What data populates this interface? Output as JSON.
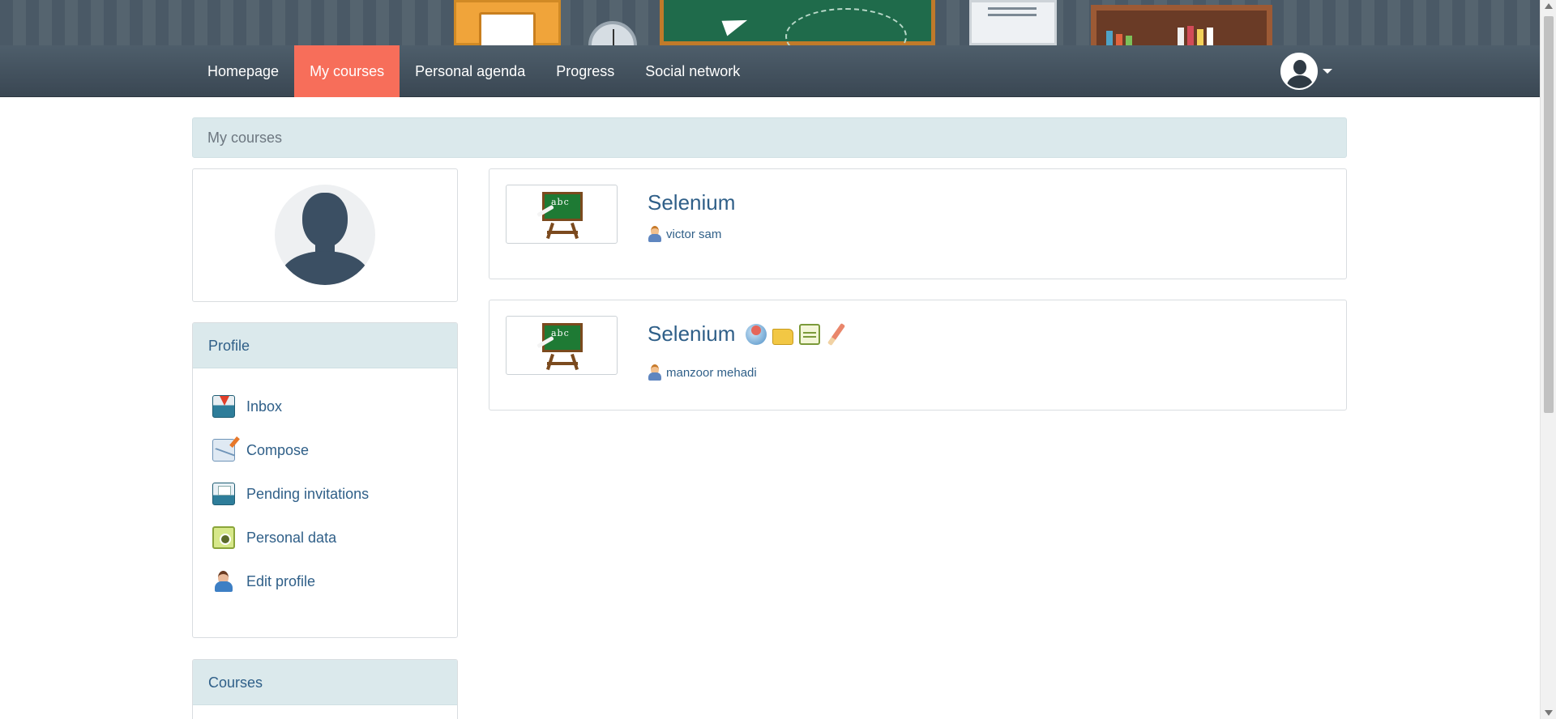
{
  "nav": {
    "items": [
      {
        "label": "Homepage",
        "active": false
      },
      {
        "label": "My courses",
        "active": true
      },
      {
        "label": "Personal agenda",
        "active": false
      },
      {
        "label": "Progress",
        "active": false
      },
      {
        "label": "Social network",
        "active": false
      }
    ],
    "active_color": "#f76e5a",
    "user_menu_icon": "user-avatar-icon"
  },
  "breadcrumb": {
    "label": "My courses"
  },
  "sidebar": {
    "profile": {
      "heading": "Profile",
      "items": [
        {
          "label": "Inbox",
          "icon": "inbox-icon"
        },
        {
          "label": "Compose",
          "icon": "compose-icon"
        },
        {
          "label": "Pending invitations",
          "icon": "pending-invitations-icon"
        },
        {
          "label": "Personal data",
          "icon": "personal-data-icon"
        },
        {
          "label": "Edit profile",
          "icon": "edit-profile-icon"
        }
      ]
    },
    "courses": {
      "heading": "Courses"
    }
  },
  "courses": [
    {
      "title": "Selenium",
      "teacher": "victor sam",
      "tools": []
    },
    {
      "title": "Selenium",
      "teacher": "manzoor mehadi",
      "tools": [
        "announcements-icon",
        "documents-icon",
        "notebook-icon",
        "assignments-icon"
      ]
    }
  ],
  "colors": {
    "link": "#2f5f88",
    "panel_heading_bg": "#dbe9ec",
    "navbar_bg": "#3a4753"
  }
}
